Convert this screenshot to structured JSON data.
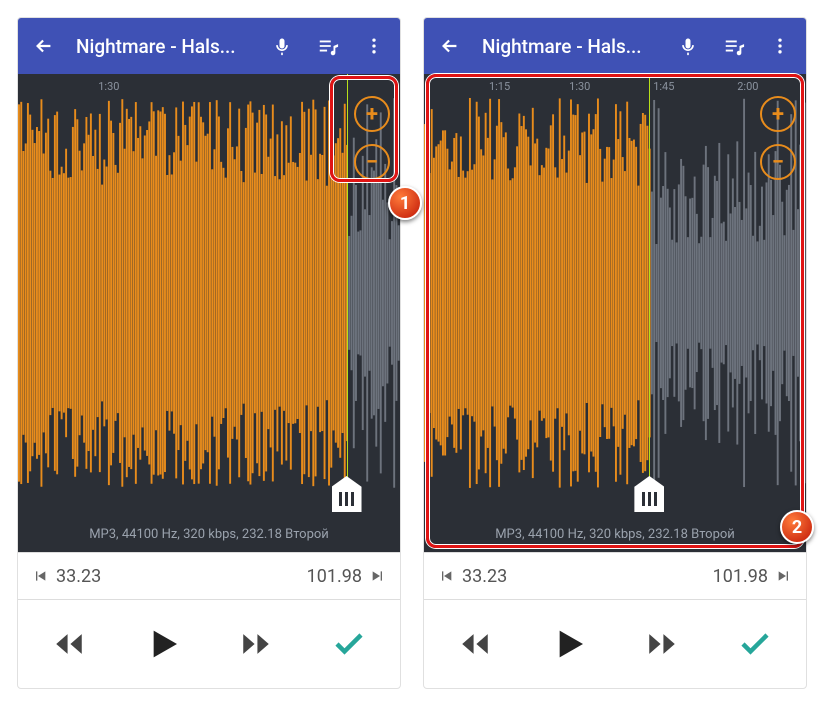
{
  "appbar": {
    "title": "Nightmare - Hals..."
  },
  "left": {
    "timemarks": [
      "1:30"
    ],
    "playhead_pct": 86,
    "selection_end_pct": 86
  },
  "right": {
    "timemarks": [
      "1:15",
      "1:30",
      "1:45",
      "2:00"
    ],
    "timemark_pos": [
      17,
      38,
      60,
      82
    ],
    "playhead_pct": 59,
    "selection_end_pct": 59
  },
  "meta": "MP3, 44100 Hz, 320 kbps, 232.18 Второй",
  "times": {
    "start": "33.23",
    "end": "101.98"
  },
  "callouts": {
    "one": "1",
    "two": "2"
  }
}
